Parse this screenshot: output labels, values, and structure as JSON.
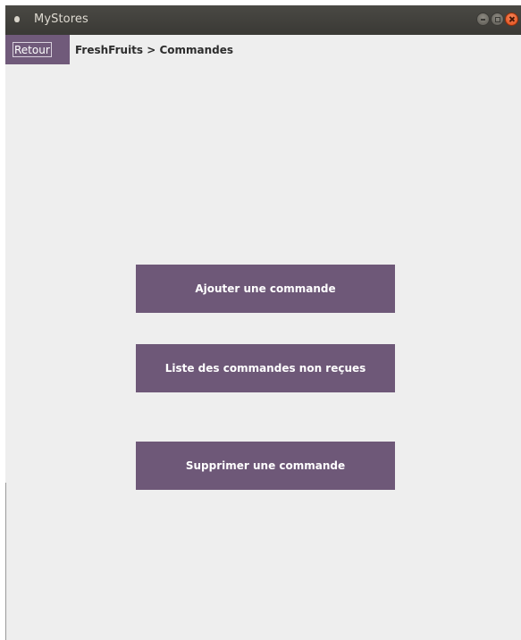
{
  "window": {
    "title": "MyStores"
  },
  "topbar": {
    "back_label": "Retour",
    "breadcrumb": "FreshFruits > Commandes"
  },
  "actions": {
    "add_label": "Ajouter une commande",
    "list_label": "Liste des commandes non reçues",
    "delete_label": "Supprimer une commande"
  },
  "colors": {
    "accent": "#6e5878",
    "background": "#eeeeee",
    "titlebar": "#3c3b37",
    "close_button": "#e9571e"
  }
}
